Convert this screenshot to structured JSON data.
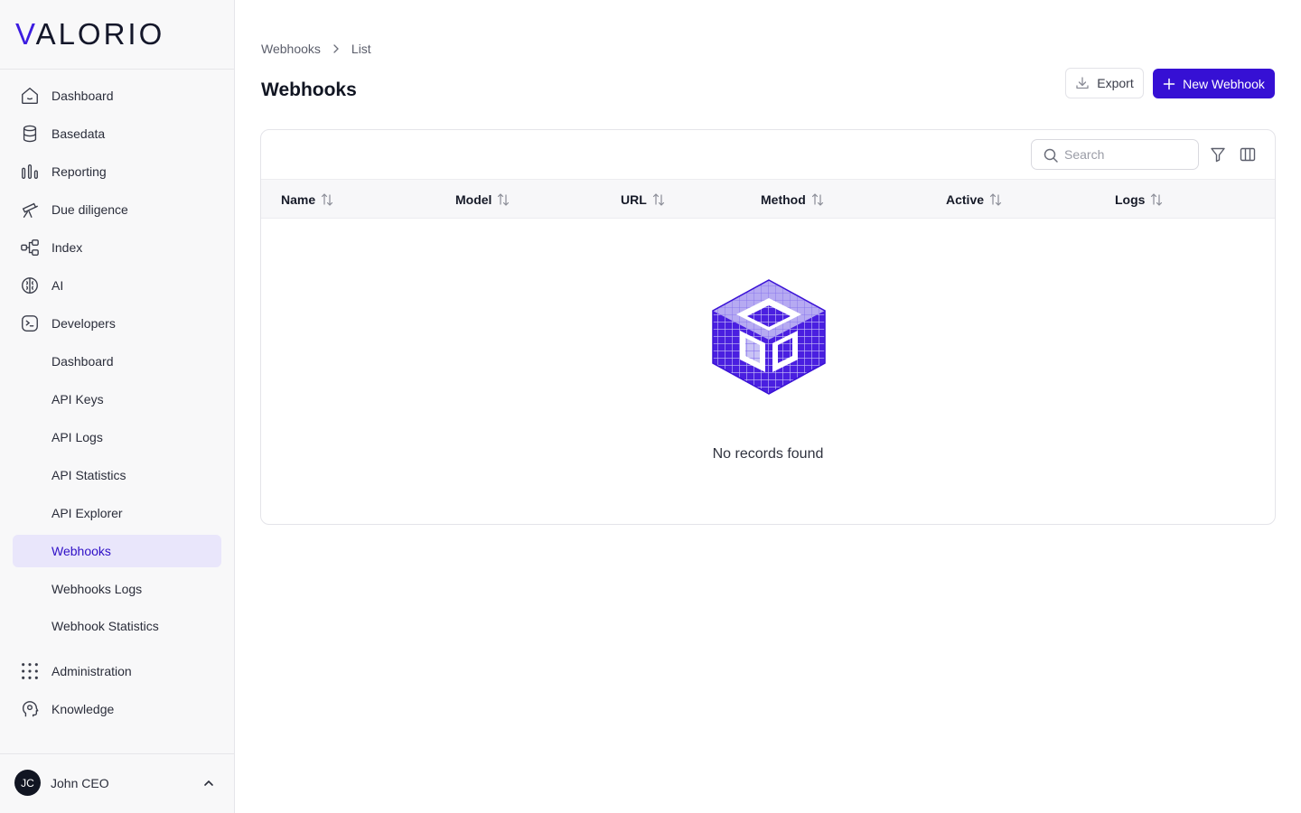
{
  "brand": {
    "logo_text_a": "V",
    "logo_text_b": "ALORIO",
    "accent_color": "#3610d4"
  },
  "sidebar": {
    "items": [
      {
        "label": "Dashboard",
        "icon": "home-icon"
      },
      {
        "label": "Basedata",
        "icon": "database-icon"
      },
      {
        "label": "Reporting",
        "icon": "bar-chart-icon"
      },
      {
        "label": "Due diligence",
        "icon": "telescope-icon"
      },
      {
        "label": "Index",
        "icon": "hierarchy-icon"
      },
      {
        "label": "AI",
        "icon": "brain-icon"
      },
      {
        "label": "Developers",
        "icon": "terminal-icon"
      }
    ],
    "developer_subitems": [
      {
        "label": "Dashboard"
      },
      {
        "label": "API Keys"
      },
      {
        "label": "API Logs"
      },
      {
        "label": "API Statistics"
      },
      {
        "label": "API Explorer"
      },
      {
        "label": "Webhooks",
        "active": true
      },
      {
        "label": "Webhooks Logs"
      },
      {
        "label": "Webhook Statistics"
      }
    ],
    "bottom_items": [
      {
        "label": "Administration",
        "icon": "grid-dots-icon"
      },
      {
        "label": "Knowledge",
        "icon": "head-icon"
      }
    ]
  },
  "user": {
    "initials": "JC",
    "name": "John CEO"
  },
  "breadcrumb": {
    "parent": "Webhooks",
    "current": "List"
  },
  "page": {
    "title": "Webhooks"
  },
  "actions": {
    "export_label": "Export",
    "new_label": "New Webhook"
  },
  "table": {
    "search_placeholder": "Search",
    "columns": [
      "Name",
      "Model",
      "URL",
      "Method",
      "Active",
      "Logs"
    ],
    "empty_message": "No records found"
  }
}
